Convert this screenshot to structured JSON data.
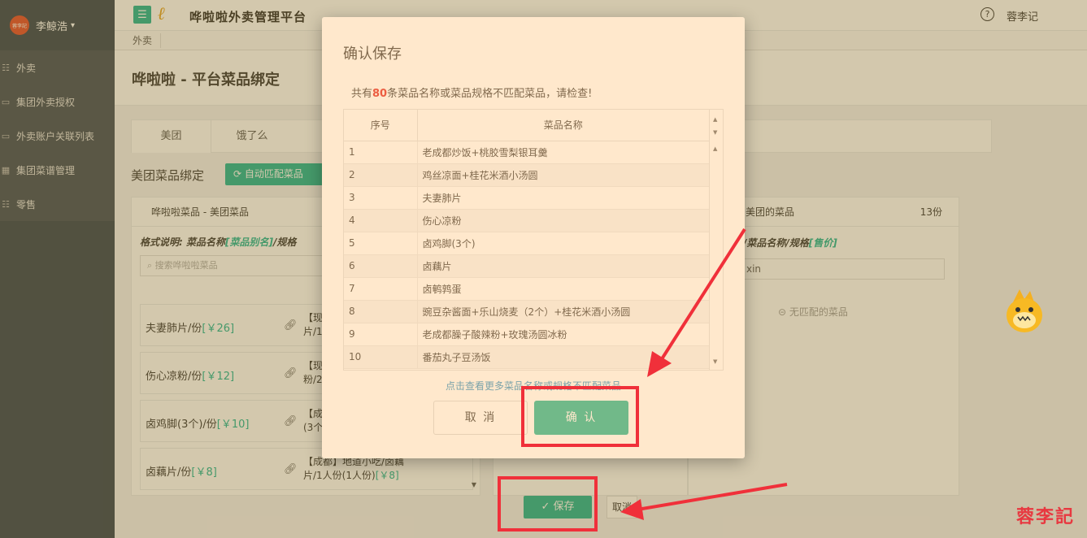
{
  "sidebar": {
    "avatar_text": "蓉李記",
    "user_name": "李鲸浩",
    "items": [
      {
        "label": "外卖"
      },
      {
        "label": "集团外卖授权"
      },
      {
        "label": "外卖账户关联列表"
      },
      {
        "label": "集团菜谱管理"
      },
      {
        "label": "零售"
      }
    ]
  },
  "header": {
    "brand": "哗啦啦外卖管理平台",
    "user": "蓉李记",
    "breadcrumb_tab": "外卖"
  },
  "page": {
    "title": "哗啦啦 - 平台菜品绑定",
    "tabs": [
      {
        "label": "美团"
      },
      {
        "label": "饿了么"
      }
    ],
    "bind_title": "美团菜品绑定",
    "auto_match_button": "自动匹配菜品",
    "left_panel": {
      "head": "哗啦啦菜品 - 美团菜品",
      "format_prefix": "格式说明: 菜品名称",
      "format_alias": "[菜品别名]",
      "format_suffix": "/规格",
      "search_placeholder": "搜索哗啦啦菜品",
      "dishes": [
        {
          "name": "夫妻肺片/份",
          "price": "[￥26]",
          "bound_prefix": "【现",
          "bound_rest": "片/1"
        },
        {
          "name": "伤心凉粉/份",
          "price": "[￥12]",
          "bound_prefix": "【现",
          "bound_rest": "粉/2"
        },
        {
          "name": "卤鸡脚(3个)/份",
          "price": "[￥10]",
          "bound_prefix": "【成",
          "bound_rest": "(3个"
        },
        {
          "name": "卤藕片/份",
          "price": "[￥8]",
          "bound_prefix": "【成都】地道小吃/卤藕",
          "bound_rest": "片/1人份(1人份)",
          "bound_price": "[￥8]"
        }
      ]
    },
    "right_panel": {
      "head": "美团的菜品",
      "count": "13份",
      "format_prefix": ": 菜品分类/菜品名称/规格",
      "format_price": "[售价]",
      "input_value": "xin",
      "empty_text": "无匹配的菜品"
    },
    "save_button": "保存",
    "cancel_button": "取消"
  },
  "modal": {
    "title": "确认保存",
    "message_prefix": "共有",
    "message_count": "80",
    "message_suffix": "条菜品名称或菜品规格不匹配菜品，请检查!",
    "columns": [
      "序号",
      "菜品名称"
    ],
    "rows": [
      [
        "1",
        "老成都炒饭+桃胶雪梨银耳羹"
      ],
      [
        "2",
        "鸡丝凉面+桂花米酒小汤圆"
      ],
      [
        "3",
        "夫妻肺片"
      ],
      [
        "4",
        "伤心凉粉"
      ],
      [
        "5",
        "卤鸡脚(3个)"
      ],
      [
        "6",
        "卤藕片"
      ],
      [
        "7",
        "卤鹌鹑蛋"
      ],
      [
        "8",
        "豌豆杂酱面+乐山烧麦（2个）+桂花米酒小汤圆"
      ],
      [
        "9",
        "老成都臊子酸辣粉+玫瑰汤圆冰粉"
      ],
      [
        "10",
        "番茄丸子豆汤饭"
      ]
    ],
    "more_link": "点击查看更多菜品名称或规格不匹配菜品",
    "cancel_label": "取 消",
    "confirm_label": "确 认"
  },
  "watermark": "蓉李記",
  "colors": {
    "accent": "#1ab394",
    "highlight": "#f0303a",
    "sidebar_bg": "#2f4050",
    "link": "#2a90c8"
  }
}
